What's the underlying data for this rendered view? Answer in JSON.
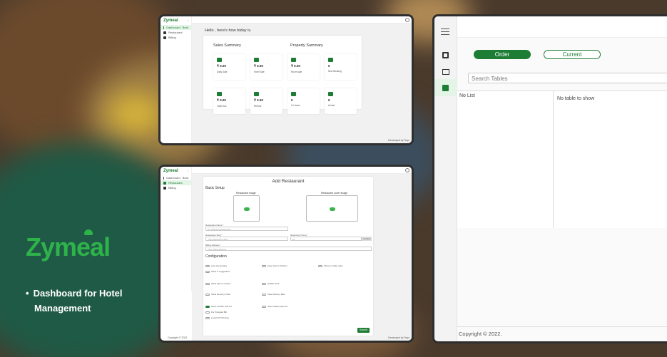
{
  "brand": {
    "name": "Zymeal"
  },
  "tagline": [
    "Dashboard for Hotel",
    "Management"
  ],
  "dash": {
    "logo": "Zymeal",
    "nav": [
      {
        "label": "Dashboard",
        "badge": "Beta"
      },
      {
        "label": "Restaurant"
      },
      {
        "label": "Billing"
      }
    ],
    "greeting": "Hello , here's how today is.",
    "sales_title": "Sales Summary",
    "property_title": "Property Summary",
    "cards": [
      {
        "value": "₹ 0.00",
        "label": "Daily Sale"
      },
      {
        "value": "₹ 0.00",
        "label": "Hotel Sale"
      },
      {
        "value": "₹ 0.00",
        "label": "Room sale"
      },
      {
        "value": "0",
        "label": "New Booking"
      },
      {
        "value": "₹ 0.00",
        "label": "Total Due"
      },
      {
        "value": "₹ 0.00",
        "label": "Refund"
      },
      {
        "value": "0",
        "label": "In House"
      },
      {
        "value": "0",
        "label": "Arrival"
      }
    ],
    "footer": "Developed by Teqo"
  },
  "add": {
    "logo": "Zymeal",
    "nav": [
      {
        "label": "Dashboard",
        "badge": "Beta"
      },
      {
        "label": "Restaurant"
      },
      {
        "label": "Billing"
      }
    ],
    "title": "Add Restaurant",
    "basic_setup": "Basic Setup",
    "logo_label": "Restaurant image",
    "cover_label": "Restaurant cover image",
    "name_label": "Restaurant Name *",
    "name_placeholder": "Ex: Delicious Restaurant",
    "slug_label": "Restaurant Slug *",
    "slug_placeholder": "Your Restaurant Slug",
    "reg_label": "Reporting Timing *",
    "reg_placeholder": "10",
    "reg_unit": "minutes",
    "billing_label": "Billing Address *",
    "billing_placeholder": "Your billing address",
    "config_title": "Configuration",
    "options": [
      "Auto Generating",
      "Keep Cart to Kitchen",
      "Show on table order",
      "Table in suggestbox",
      "Table Menu Location",
      "Enable KOT",
      "Table Delivery Order",
      "Take Delivery Bills",
      "Allow checkin with sto",
      "Show Sales payment",
      "For Postpaid Bill",
      "Load KOT Printing"
    ],
    "submit": "Submit",
    "footer_left": "Copyright © 2022.",
    "footer_right": "Developed by Teqo"
  },
  "pos": {
    "order_btn": "Order",
    "current_btn": "Current",
    "search_placeholder": "Search Tables",
    "no_list": "No List",
    "no_table": "No table to show",
    "copyright": "Copyright © 2022."
  }
}
